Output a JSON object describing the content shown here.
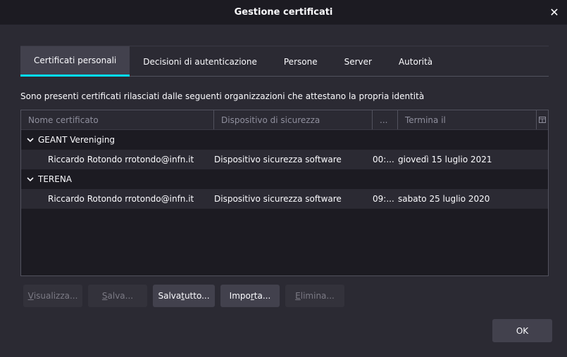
{
  "window": {
    "title": "Gestione certificati",
    "close_glyph": "✕"
  },
  "tabs": [
    {
      "label": "Certificati personali",
      "active": true
    },
    {
      "label": "Decisioni di autenticazione",
      "active": false
    },
    {
      "label": "Persone",
      "active": false
    },
    {
      "label": "Server",
      "active": false
    },
    {
      "label": "Autorità",
      "active": false
    }
  ],
  "intro_text": "Sono presenti certificati rilasciati dalle seguenti organizzazioni che attestano la propria identità",
  "table": {
    "columns": [
      "Nome certificato",
      "Dispositivo di sicurezza",
      "...",
      "Termina il"
    ],
    "groups": [
      {
        "name": "GEANT Vereniging",
        "rows": [
          {
            "name": "Riccardo Rotondo rrotondo@infn.it",
            "device": "Dispositivo sicurezza software",
            "serial": "00:...",
            "expires": "giovedì 15 luglio 2021"
          }
        ]
      },
      {
        "name": "TERENA",
        "rows": [
          {
            "name": "Riccardo Rotondo rrotondo@infn.it",
            "device": "Dispositivo sicurezza software",
            "serial": "09:...",
            "expires": "sabato 25 luglio 2020"
          }
        ]
      }
    ]
  },
  "buttons": {
    "view": {
      "pre": "",
      "key": "V",
      "post": "isualizza...",
      "disabled": true
    },
    "save": {
      "pre": "",
      "key": "S",
      "post": "alva...",
      "disabled": true
    },
    "save_all": {
      "pre": "Salva ",
      "key": "t",
      "post": "utto...",
      "disabled": false
    },
    "import": {
      "pre": "Impo",
      "key": "r",
      "post": "ta...",
      "disabled": false
    },
    "delete": {
      "pre": "",
      "key": "E",
      "post": "limina...",
      "disabled": true
    },
    "ok": "OK"
  },
  "icons": {
    "twisty": "chevron-down-icon",
    "column_picker": "column-picker-icon"
  },
  "colors": {
    "accent": "#00ddff",
    "background": "#2b2a33",
    "titlebar": "#1c1b22"
  }
}
